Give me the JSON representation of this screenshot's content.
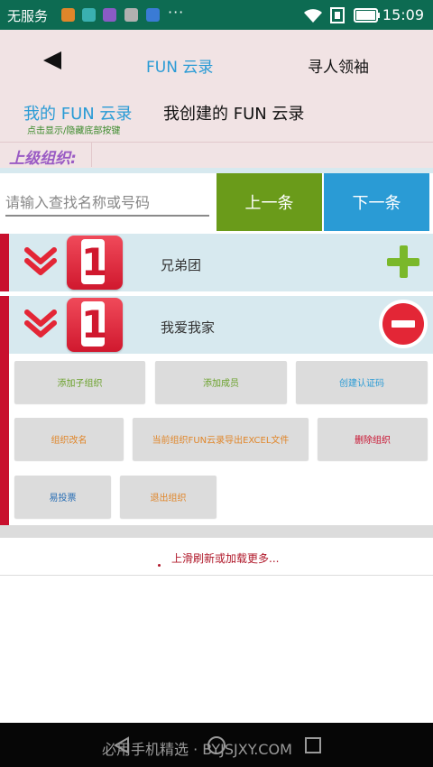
{
  "status_bar": {
    "carrier": "无服务",
    "time": "15:09",
    "overflow": "···",
    "icons": [
      "app-icon-orange",
      "app-icon-teal",
      "app-icon-purple",
      "app-icon-gray",
      "app-icon-blue",
      "wifi-icon",
      "data-icon",
      "battery-icon"
    ]
  },
  "header": {
    "back_icon": "back-arrow-icon",
    "nav_fun": "FUN 云录",
    "nav_seek": "寻人领袖"
  },
  "tabs": {
    "my_fun": "我的 FUN 云录",
    "my_fun_hint": "点击显示/隐藏底部按键",
    "created_fun": "我创建的 FUN 云录"
  },
  "parent_org": {
    "label": "上级组织:"
  },
  "search": {
    "placeholder": "请输入查找名称或号码",
    "prev_label": "上一条",
    "next_label": "下一条"
  },
  "orgs": [
    {
      "badge": "1",
      "name": "兄弟团",
      "action_icon": "plus-icon"
    },
    {
      "badge": "1",
      "name": "我爱我家",
      "action_icon": "minus-icon"
    }
  ],
  "actions": [
    {
      "label": "添加子组织",
      "color": "#6aa12a"
    },
    {
      "label": "添加成员",
      "color": "#6aa12a"
    },
    {
      "label": "创建认证码",
      "color": "#2a9bd5"
    },
    {
      "label": "组织改名",
      "color": "#e0862a"
    },
    {
      "label": "当前组织FUN云录导出EXCEL文件",
      "color": "#e0862a"
    },
    {
      "label": "删除组织",
      "color": "#c8102e"
    },
    {
      "label": "易投票",
      "color": "#2a6fb5"
    },
    {
      "label": "退出组织",
      "color": "#e0862a"
    }
  ],
  "load_more": "上滑刷新或加载更多...",
  "nav_bar": {
    "watermark": "必用手机精选 · BYJSJXY.COM",
    "buttons": [
      "back-triangle-icon",
      "home-circle-icon",
      "recents-square-icon"
    ]
  },
  "colors": {
    "status_bar": "#0d6b52",
    "header_bg": "#f1e3e4",
    "accent_blue": "#2a9bd5",
    "accent_green": "#6a9b1a",
    "accent_red": "#c8102e",
    "row_bg": "#d7e9ef"
  }
}
